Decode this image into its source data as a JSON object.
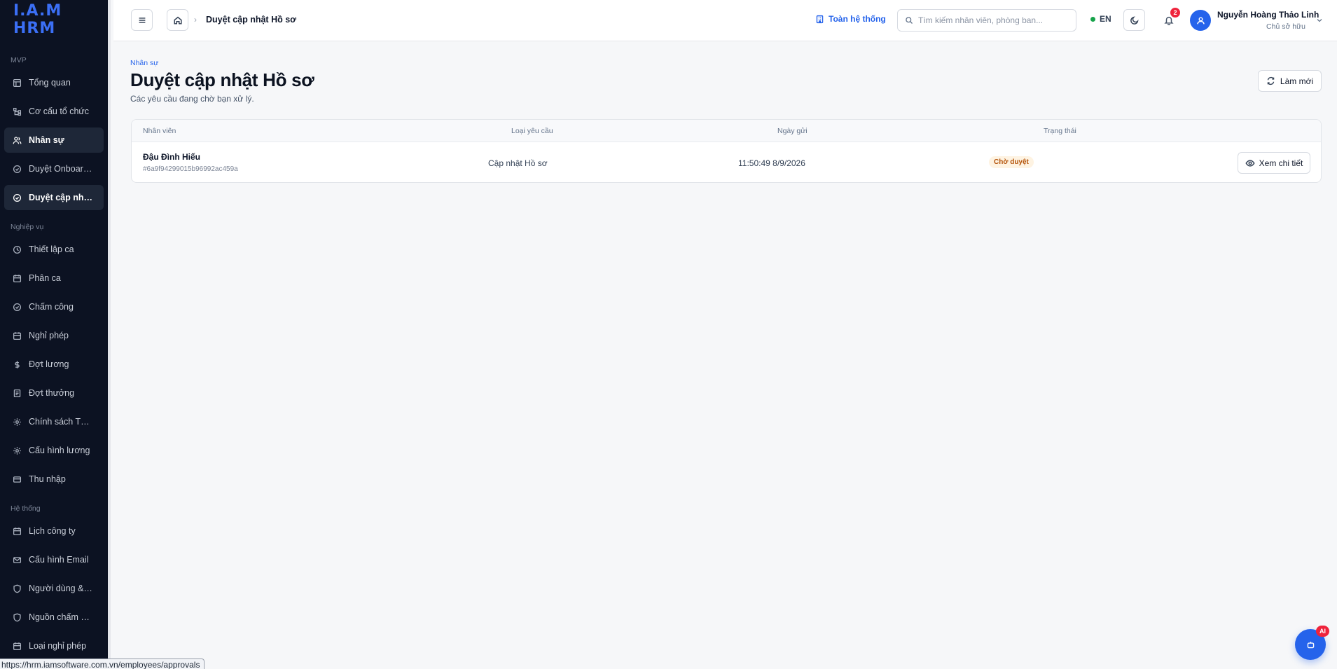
{
  "brand": {
    "logo_text": "I.A.M HRM"
  },
  "sidebar": {
    "sections": [
      {
        "label": "MVP"
      },
      {
        "label": "Nghiệp vụ"
      },
      {
        "label": "Hệ thống"
      }
    ],
    "items": [
      {
        "label": "Tổng quan",
        "icon": "dashboard-icon"
      },
      {
        "label": "Cơ cấu tổ chức",
        "icon": "org-structure-icon"
      },
      {
        "label": "Nhân sự",
        "icon": "users-icon",
        "active": true
      },
      {
        "label": "Duyệt Onboarding",
        "icon": "check-circle-icon"
      },
      {
        "label": "Duyệt cập nhật Hồ sơ",
        "icon": "check-circle-icon",
        "active": true
      },
      {
        "label": "Thiết lập ca",
        "icon": "clock-icon"
      },
      {
        "label": "Phân ca",
        "icon": "calendar-icon"
      },
      {
        "label": "Chấm công",
        "icon": "check-circle-icon"
      },
      {
        "label": "Nghỉ phép",
        "icon": "calendar-icon"
      },
      {
        "label": "Đợt lương",
        "icon": "dollar-icon"
      },
      {
        "label": "Đợt thưởng",
        "icon": "receipt-icon"
      },
      {
        "label": "Chính sách Thưởng",
        "icon": "gear-icon"
      },
      {
        "label": "Cấu hình lương",
        "icon": "gear-icon"
      },
      {
        "label": "Thu nhập",
        "icon": "wallet-icon"
      },
      {
        "label": "Lịch công ty",
        "icon": "calendar-icon"
      },
      {
        "label": "Cấu hình Email",
        "icon": "mail-icon"
      },
      {
        "label": "Người dùng & Phân quyền",
        "icon": "shield-icon"
      },
      {
        "label": "Nguồn chấm công",
        "icon": "shield-icon"
      },
      {
        "label": "Loại nghỉ phép",
        "icon": "calendar-icon"
      }
    ]
  },
  "header": {
    "breadcrumb_sep": "›",
    "breadcrumb_current": "Duyệt cập nhật Hồ sơ",
    "scope_label": "Toàn hệ thống",
    "search_placeholder": "Tìm kiếm nhân viên, phòng ban...",
    "lang": "EN",
    "notification_count": "2",
    "user_name": "Nguyễn Hoàng Thảo Linh",
    "user_role": "Chủ sở hữu"
  },
  "page": {
    "eyebrow": "Nhân sự",
    "title": "Duyệt cập nhật Hồ sơ",
    "subtitle": "Các yêu cầu đang chờ bạn xử lý.",
    "refresh_label": "Làm mới"
  },
  "table": {
    "columns": [
      "Nhân viên",
      "Loại yêu cầu",
      "Ngày gửi",
      "Trạng thái"
    ],
    "rows": [
      {
        "employee_name": "Đậu Đình Hiếu",
        "employee_id": "#6a9f94299015b96992ac459a",
        "request_type": "Cập nhật Hồ sơ",
        "submitted_at": "11:50:49 8/9/2026",
        "status": "Chờ duyệt",
        "action_label": "Xem chi tiết"
      }
    ]
  },
  "ai_fab": {
    "badge": "AI"
  },
  "status_url": "https://hrm.iamsoftware.com.vn/employees/approvals",
  "colors": {
    "accent": "#2563eb",
    "sidebar_bg": "#0c1222",
    "badge": "#ef233c",
    "pending": "#b45309"
  }
}
